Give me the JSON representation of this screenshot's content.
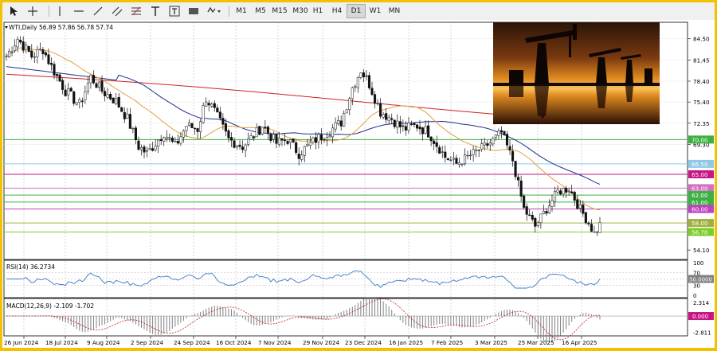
{
  "toolbar": {
    "tools": [
      "cursor-icon",
      "crosshair-icon",
      "vertical-line-icon",
      "horizontal-line-icon",
      "trendline-icon",
      "channel-icon",
      "fibonacci-icon",
      "text-icon",
      "label-icon",
      "rectangle-icon",
      "shapes-icon"
    ],
    "timeframes": [
      "M1",
      "M5",
      "M15",
      "M30",
      "H1",
      "H4",
      "D1",
      "W1",
      "MN"
    ],
    "active_timeframe": "D1"
  },
  "chart": {
    "header": "WTI,Daily  56.89 57.86 56.78 57.74",
    "price_axis": [
      "84.50",
      "81.45",
      "78.40",
      "75.40",
      "72.35",
      "69.30",
      "54.10"
    ],
    "levels": [
      {
        "label": "70.00",
        "price": 70.0,
        "color": "#3cb043"
      },
      {
        "label": "66.50",
        "price": 66.5,
        "color": "#90c8e8"
      },
      {
        "label": "65.00",
        "price": 65.0,
        "color": "#c71585"
      },
      {
        "label": "63.00",
        "price": 63.0,
        "color": "#d070c0"
      },
      {
        "label": "62.00",
        "price": 62.0,
        "color": "#3cb043"
      },
      {
        "label": "61.00",
        "price": 61.0,
        "color": "#3cb043"
      },
      {
        "label": "60.00",
        "price": 60.0,
        "color": "#c040c0"
      },
      {
        "label": "58.00",
        "price": 58.0,
        "color": "#a0b040"
      },
      {
        "label": "56.70",
        "price": 56.7,
        "color": "#7ccd2a"
      }
    ],
    "date_labels": [
      "26 Jun 2024",
      "18 Jul 2024",
      "9 Aug 2024",
      "2 Sep 2024",
      "24 Sep 2024",
      "16 Oct 2024",
      "7 Nov 2024",
      "29 Nov 2024",
      "23 Dec 2024",
      "16 Jan 2025",
      "7 Feb 2025",
      "3 Mar 2025",
      "25 Mar 2025",
      "16 Apr 2025"
    ]
  },
  "rsi": {
    "header": "RSI(14) 36.2734",
    "axis": [
      "100",
      "70",
      "50",
      "30",
      "0"
    ],
    "level_label": "50.0000"
  },
  "macd": {
    "header": "MACD(12,26,9) -2.109 -1.702",
    "axis": [
      "2.314",
      "0.000",
      "-2.811"
    ]
  },
  "colors": {
    "ma_fast": "#e0a040",
    "ma_mid": "#1f2f8f",
    "ma_slow": "#d02020",
    "candle": "#111111",
    "rsi_line": "#3a78c8",
    "macd_signal": "#c02020"
  },
  "photo": {
    "icon": "oil-pumpjack-sunset-image"
  }
}
